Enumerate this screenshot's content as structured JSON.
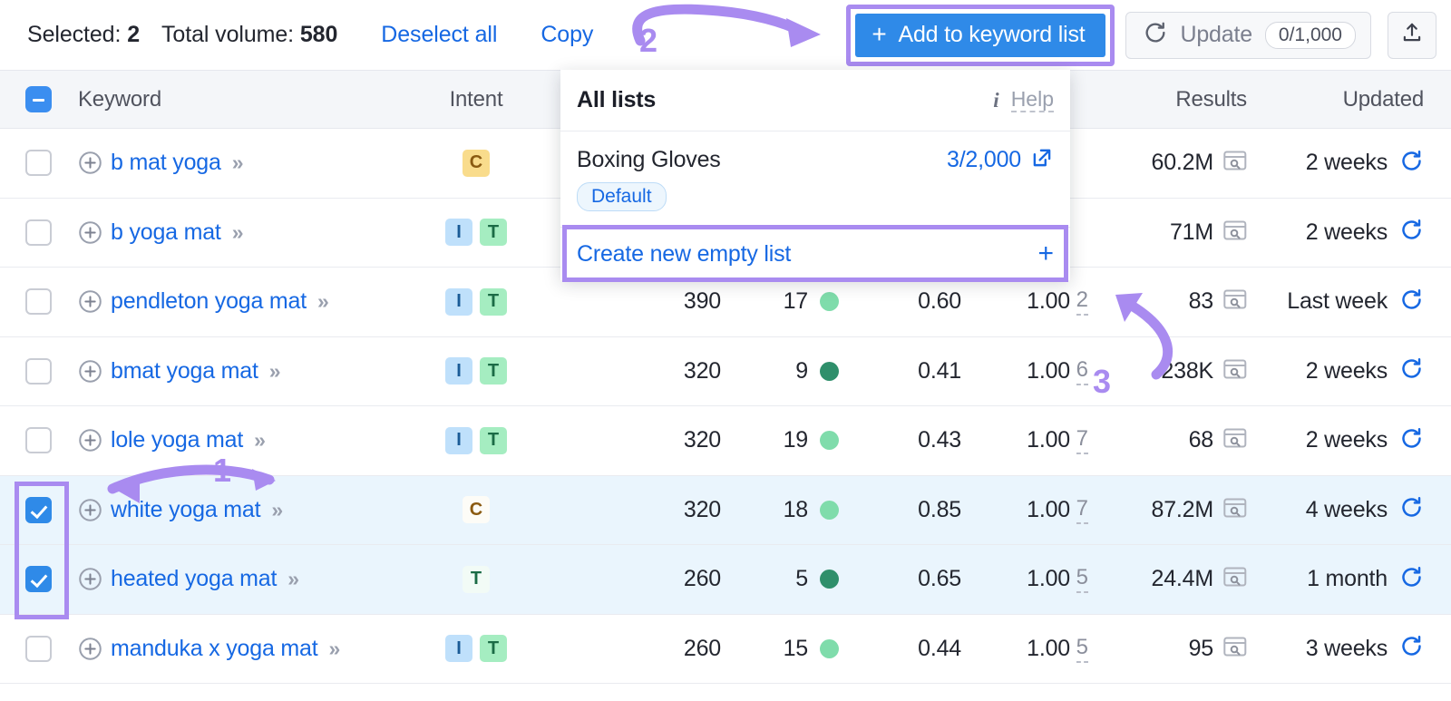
{
  "toolbar": {
    "selected_label": "Selected:",
    "selected_count": "2",
    "volume_label": "Total volume:",
    "volume_value": "580",
    "deselect_all": "Deselect all",
    "copy": "Copy",
    "add_to_keyword_list": "Add to keyword list",
    "add_plus": "+",
    "update_label": "Update",
    "update_quota": "0/1,000",
    "accent_blue": "#2f8ae8",
    "annotation_purple": "#a98bf0"
  },
  "table": {
    "headers": {
      "keyword": "Keyword",
      "intent": "Intent",
      "results": "Results",
      "updated": "Updated"
    },
    "rows": [
      {
        "keyword": "b mat yoga",
        "intent": [
          "C"
        ],
        "volume": "",
        "kd": "",
        "kd_color": "",
        "cpc": "",
        "com": "",
        "sf": "",
        "results": "60.2M",
        "updated": "2 weeks",
        "selected": false
      },
      {
        "keyword": "b yoga mat",
        "intent": [
          "I",
          "T"
        ],
        "volume": "",
        "kd": "",
        "kd_color": "",
        "cpc": "",
        "com": "",
        "sf": "",
        "results": "71M",
        "updated": "2 weeks",
        "selected": false
      },
      {
        "keyword": "pendleton yoga mat",
        "intent": [
          "I",
          "T"
        ],
        "volume": "390",
        "kd": "17",
        "kd_color": "#7fdcab",
        "cpc": "0.60",
        "com": "1.00",
        "sf": "2",
        "results": "83",
        "updated": "Last week",
        "selected": false
      },
      {
        "keyword": "bmat yoga mat",
        "intent": [
          "I",
          "T"
        ],
        "volume": "320",
        "kd": "9",
        "kd_color": "#2f8f6b",
        "cpc": "0.41",
        "com": "1.00",
        "sf": "6",
        "results": "238K",
        "updated": "2 weeks",
        "selected": false
      },
      {
        "keyword": "lole yoga mat",
        "intent": [
          "I",
          "T"
        ],
        "volume": "320",
        "kd": "19",
        "kd_color": "#7fdcab",
        "cpc": "0.43",
        "com": "1.00",
        "sf": "7",
        "results": "68",
        "updated": "2 weeks",
        "selected": false
      },
      {
        "keyword": "white yoga mat",
        "intent": [
          "C"
        ],
        "volume": "320",
        "kd": "18",
        "kd_color": "#7fdcab",
        "cpc": "0.85",
        "com": "1.00",
        "sf": "7",
        "results": "87.2M",
        "updated": "4 weeks",
        "selected": true
      },
      {
        "keyword": "heated yoga mat",
        "intent": [
          "T"
        ],
        "volume": "260",
        "kd": "5",
        "kd_color": "#2f8f6b",
        "cpc": "0.65",
        "com": "1.00",
        "sf": "5",
        "results": "24.4M",
        "updated": "1 month",
        "selected": true
      },
      {
        "keyword": "manduka x yoga mat",
        "intent": [
          "I",
          "T"
        ],
        "volume": "260",
        "kd": "15",
        "kd_color": "#7fdcab",
        "cpc": "0.44",
        "com": "1.00",
        "sf": "5",
        "results": "95",
        "updated": "3 weeks",
        "selected": false
      }
    ]
  },
  "dropdown": {
    "title": "All lists",
    "help": "Help",
    "list_name": "Boxing Gloves",
    "list_count": "3/2,000",
    "default_badge": "Default",
    "create_label": "Create new empty list",
    "create_plus": "+"
  },
  "annotations": {
    "step1": "1",
    "step2": "2",
    "step3": "3"
  }
}
